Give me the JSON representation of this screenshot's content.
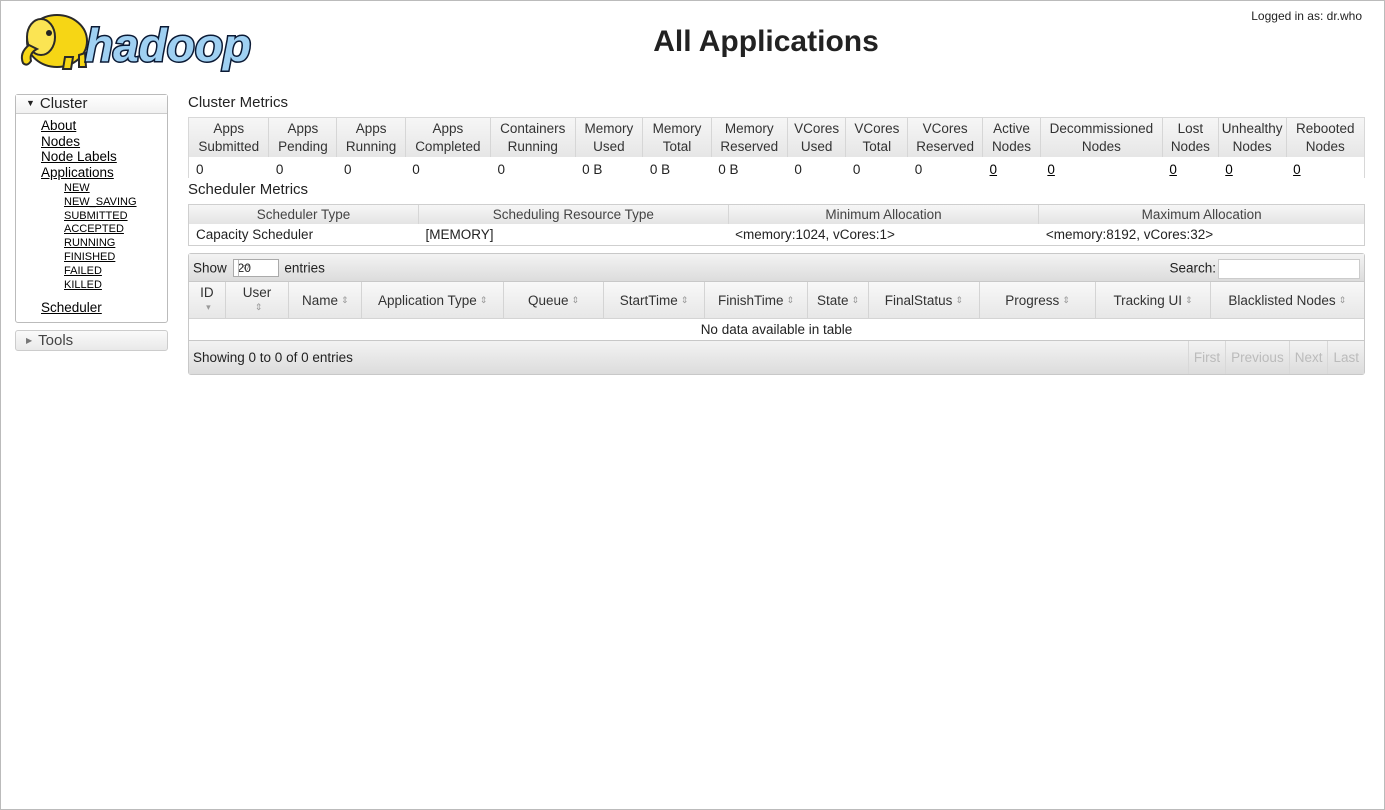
{
  "header": {
    "login_text": "Logged in as: dr.who",
    "title": "All Applications",
    "logo_text": "hadoop"
  },
  "sidebar": {
    "cluster_label": "Cluster",
    "links": [
      "About",
      "Nodes",
      "Node Labels",
      "Applications"
    ],
    "app_states": [
      "NEW",
      "NEW_SAVING",
      "SUBMITTED",
      "ACCEPTED",
      "RUNNING",
      "FINISHED",
      "FAILED",
      "KILLED"
    ],
    "scheduler_label": "Scheduler",
    "tools_label": "Tools"
  },
  "cluster_metrics": {
    "title": "Cluster Metrics",
    "headers": [
      [
        "Apps",
        "Submitted"
      ],
      [
        "Apps",
        "Pending"
      ],
      [
        "Apps",
        "Running"
      ],
      [
        "Apps",
        "Completed"
      ],
      [
        "Containers",
        "Running"
      ],
      [
        "Memory",
        "Used"
      ],
      [
        "Memory",
        "Total"
      ],
      [
        "Memory",
        "Reserved"
      ],
      [
        "VCores",
        "Used"
      ],
      [
        "VCores",
        "Total"
      ],
      [
        "VCores",
        "Reserved"
      ],
      [
        "Active",
        "Nodes"
      ],
      [
        "Decommissioned",
        "Nodes"
      ],
      [
        "Lost",
        "Nodes"
      ],
      [
        "Unhealthy",
        "Nodes"
      ],
      [
        "Rebooted",
        "Nodes"
      ]
    ],
    "values": [
      "0",
      "0",
      "0",
      "0",
      "0",
      "0 B",
      "0 B",
      "0 B",
      "0",
      "0",
      "0",
      "0",
      "0",
      "0",
      "0",
      "0"
    ]
  },
  "scheduler_metrics": {
    "title": "Scheduler Metrics",
    "headers": [
      "Scheduler Type",
      "Scheduling Resource Type",
      "Minimum Allocation",
      "Maximum Allocation"
    ],
    "values": [
      "Capacity Scheduler",
      "[MEMORY]",
      "<memory:1024, vCores:1>",
      "<memory:8192, vCores:32>"
    ]
  },
  "apps_table": {
    "show_label": "Show",
    "entries_value": "20",
    "entries_label": "entries",
    "search_label": "Search:",
    "search_value": "",
    "columns": [
      "ID",
      "User",
      "Name",
      "Application Type",
      "Queue",
      "StartTime",
      "FinishTime",
      "State",
      "FinalStatus",
      "Progress",
      "Tracking UI",
      "Blacklisted Nodes"
    ],
    "empty_message": "No data available in table",
    "info": "Showing 0 to 0 of 0 entries",
    "pager": [
      "First",
      "Previous",
      "Next",
      "Last"
    ]
  }
}
